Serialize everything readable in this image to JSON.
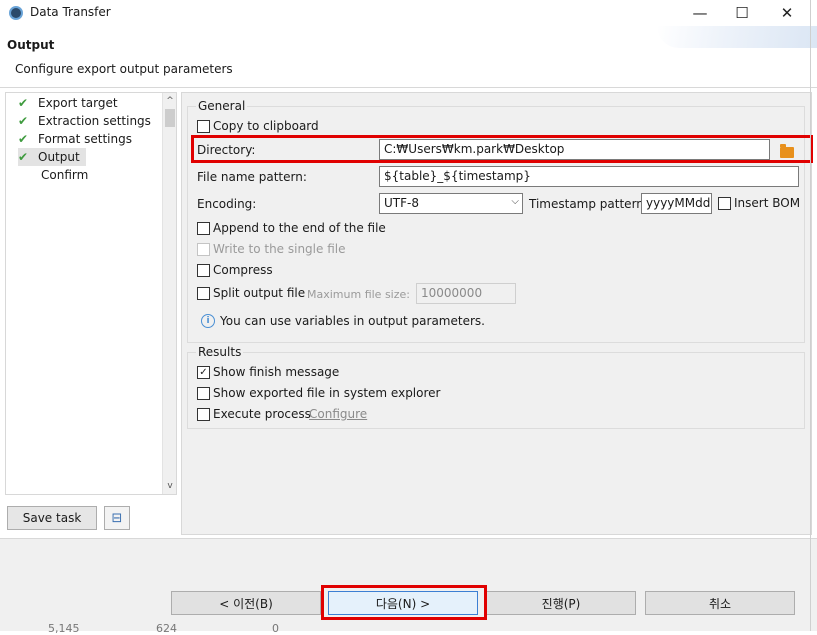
{
  "window": {
    "title": "Data Transfer",
    "minimize_glyph": "—",
    "maximize_glyph": "☐",
    "close_glyph": "✕"
  },
  "header": {
    "title": "Output",
    "description": "Configure export output parameters"
  },
  "nav": {
    "items": [
      {
        "label": "Export target",
        "done": true
      },
      {
        "label": "Extraction settings",
        "done": true
      },
      {
        "label": "Format settings",
        "done": true
      },
      {
        "label": "Output",
        "done": true,
        "active": true
      },
      {
        "label": "Confirm",
        "done": false
      }
    ],
    "check_glyph": "✔",
    "scroll_up": "^",
    "scroll_down": "v"
  },
  "save_task": {
    "label": "Save task",
    "icon": "save-task-icon",
    "icon_glyph": "⊟"
  },
  "general": {
    "legend": "General",
    "copy_to_clipboard": {
      "label": "Copy to clipboard",
      "checked": false
    },
    "directory": {
      "label": "Directory:",
      "value": "C:₩Users₩km.park₩Desktop"
    },
    "file_name_pattern": {
      "label": "File name pattern:",
      "value": "${table}_${timestamp}"
    },
    "encoding": {
      "label": "Encoding:",
      "value": "UTF-8",
      "arrow": "⌵"
    },
    "timestamp_pattern": {
      "label": "Timestamp pattern:",
      "value": "yyyyMMddHHmm"
    },
    "insert_bom": {
      "label": "Insert BOM",
      "checked": false
    },
    "append": {
      "label": "Append to the end of the file",
      "checked": false
    },
    "single_file": {
      "label": "Write to the single file",
      "checked": false,
      "disabled": true
    },
    "compress": {
      "label": "Compress",
      "checked": false
    },
    "split_output": {
      "label": "Split output file",
      "checked": false
    },
    "max_file_size": {
      "label": "Maximum file size:",
      "value": "10000000"
    },
    "info": {
      "text": "You can use variables in output parameters.",
      "glyph": "i"
    }
  },
  "results": {
    "legend": "Results",
    "show_finish_message": {
      "label": "Show finish message",
      "checked": true
    },
    "show_exported_file": {
      "label": "Show exported file in system explorer",
      "checked": false
    },
    "execute_process": {
      "label": "Execute process",
      "checked": false
    },
    "configure_link": "Configure",
    "check_glyph": "✓"
  },
  "buttons": {
    "back": "< 이전(B)",
    "next": "다음(N) >",
    "proceed": "진행(P)",
    "cancel": "취소"
  },
  "colors": {
    "highlight_red": "#e00000",
    "check_green": "#3f9b3f",
    "folder_orange": "#e8901c",
    "primary_blue": "#3c7fd3"
  },
  "footer_ghost": [
    "5,145",
    "624",
    "0"
  ]
}
